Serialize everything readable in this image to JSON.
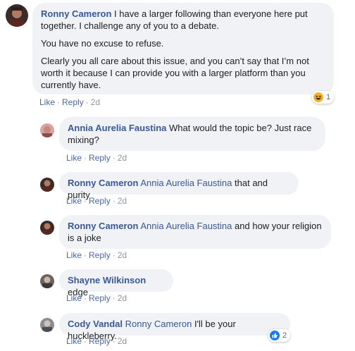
{
  "comments": [
    {
      "author": "Ronny Cameron",
      "paragraphs": [
        "I have a larger following than everyone here put together. I challenge any of you to a debate.",
        "You have no excuse to refuse.",
        "Clearly you all care about this issue, and you can’t say that I’m not worth it because I can provide you with a larger platform than you currently have."
      ],
      "reaction": {
        "icon": "laugh-reaction-icon",
        "count": "1"
      }
    },
    {
      "author": "Annia Aurelia Faustina",
      "mention": "",
      "text": "What would the topic be? Just race mixing?"
    },
    {
      "author": "Ronny Cameron",
      "mention": "Annia Aurelia Faustina",
      "text": "that and purity"
    },
    {
      "author": "Ronny Cameron",
      "mention": "Annia Aurelia Faustina",
      "text": "and how your religion is a joke"
    },
    {
      "author": "Shayne Wilkinson",
      "mention": "",
      "text": "edge"
    },
    {
      "author": "Cody Vandal",
      "mention": "Ronny Cameron",
      "text": "I'll be your huckleberry.",
      "reaction": {
        "icon": "like-reaction-icon",
        "count": "2"
      }
    }
  ],
  "actions": {
    "like": "Like",
    "reply": "Reply",
    "time": "2d",
    "dot": "·"
  },
  "colors": {
    "bubble": "#f0f2f5",
    "author": "#385898",
    "link": "#4b67a1",
    "meta": "#90949c"
  }
}
